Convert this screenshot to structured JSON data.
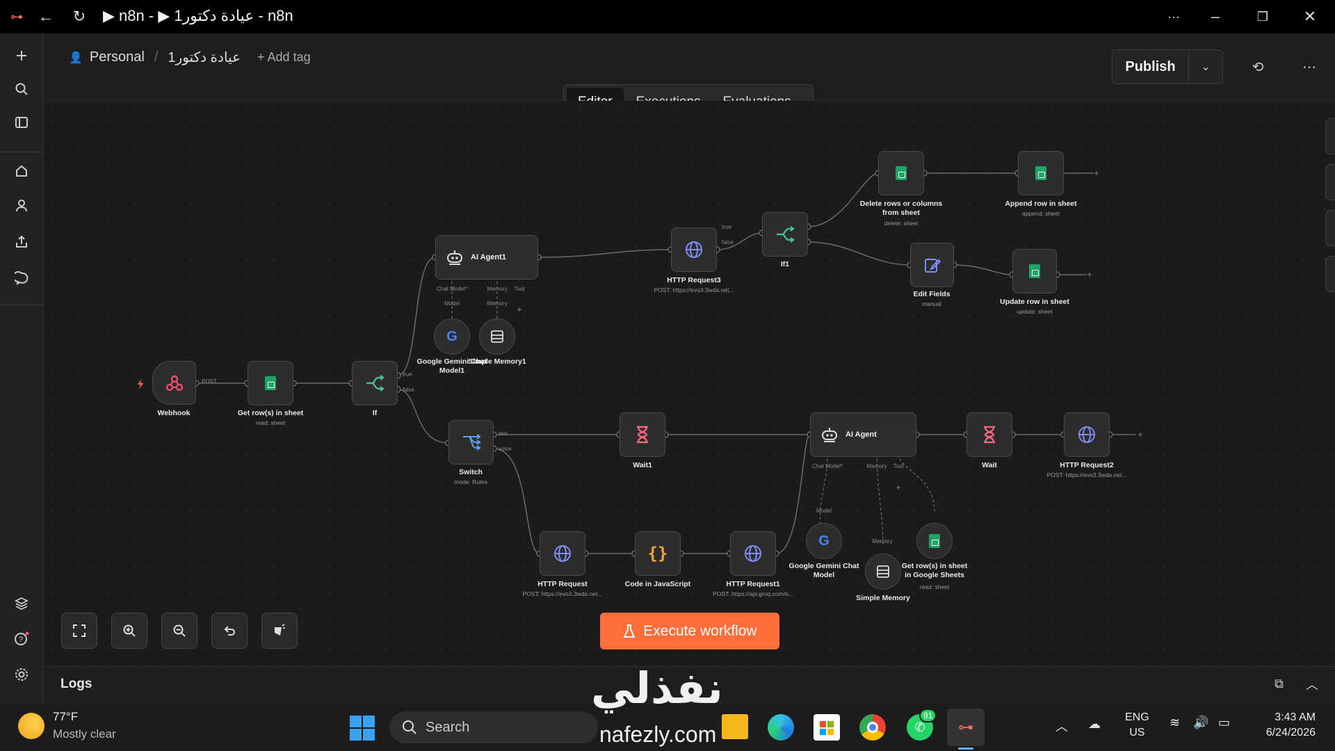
{
  "window": {
    "title": "▶ n8n - ▶ عيادة دكتور1 - n8n",
    "menu_dots": "···"
  },
  "header": {
    "breadcrumb_owner": "Personal",
    "separator": "/",
    "workflow_name": "عيادة دكتور1",
    "add_tag": "+ Add tag",
    "publish_label": "Publish"
  },
  "tabs": [
    "Editor",
    "Executions",
    "Evaluations"
  ],
  "nodes": {
    "webhook": {
      "label": "Webhook",
      "port": "POST"
    },
    "get_rows": {
      "label": "Get row(s) in sheet",
      "sub": "read: sheet"
    },
    "if": {
      "label": "If",
      "true": "true",
      "false": "false"
    },
    "ai_agent1": {
      "label": "AI Agent1",
      "p_chat": "Chat Model*",
      "p_memory": "Memory",
      "p_tool": "Tool",
      "l_model": "Model",
      "l_memory": "Memory"
    },
    "gemini1": {
      "label1": "Google Gemini Chat",
      "label2": "Model1"
    },
    "simple_memory1": {
      "label": "Simple Memory1"
    },
    "http3": {
      "label": "HTTP Request3",
      "sub": "POST: https://evo3.3wda.net..."
    },
    "if1": {
      "label": "If1",
      "true": "true",
      "false": "false"
    },
    "delete_rows": {
      "label1": "Delete rows or columns",
      "label2": "from sheet",
      "sub": "delete: sheet"
    },
    "append_row": {
      "label": "Append row in sheet",
      "sub": "append: sheet"
    },
    "edit_fields": {
      "label": "Edit Fields",
      "sub": "manual"
    },
    "update_row": {
      "label": "Update row in sheet",
      "sub": "update: sheet"
    },
    "switch": {
      "label": "Switch",
      "sub": "mode: Rules",
      "p_text": "text",
      "p_voice": "voice"
    },
    "wait1": {
      "label": "Wait1"
    },
    "ai_agent": {
      "label": "AI Agent",
      "p_chat": "Chat Model*",
      "p_memory": "Memory",
      "p_tool": "Tool",
      "l_model": "Model",
      "l_memory": "Memory"
    },
    "wait": {
      "label": "Wait"
    },
    "http2": {
      "label": "HTTP Request2",
      "sub": "POST: https://evo3.3wda.net..."
    },
    "http": {
      "label": "HTTP Request",
      "sub": "POST: https://evo3.3wda.net..."
    },
    "code_js": {
      "label": "Code in JavaScript"
    },
    "http1": {
      "label": "HTTP Request1",
      "sub": "POST: https://api.groq.com/o..."
    },
    "gemini": {
      "label1": "Google Gemini Chat",
      "label2": "Model"
    },
    "simple_memory": {
      "label": "Simple Memory"
    },
    "get_rows_gs": {
      "label1": "Get row(s) in sheet",
      "label2": "in Google Sheets",
      "sub": "read: sheet"
    }
  },
  "execute_button": "Execute workflow",
  "logs": {
    "label": "Logs"
  },
  "taskbar": {
    "temp": "77°F",
    "weather": "Mostly clear",
    "search": "Search",
    "whatsapp_badge": "91",
    "lang1": "ENG",
    "lang2": "US",
    "time": "3:43 AM",
    "date": "6/24/2026"
  },
  "watermark": {
    "arabic": "نفذلي",
    "latin": "nafezly.com"
  },
  "colors": {
    "accent": "#ff6d3a",
    "sheets": "#1fa463",
    "http": "#7f8cf5",
    "wait": "#ff6b81",
    "code": "#f0a53a",
    "if": "#47c49a",
    "switch": "#5e9dff"
  }
}
